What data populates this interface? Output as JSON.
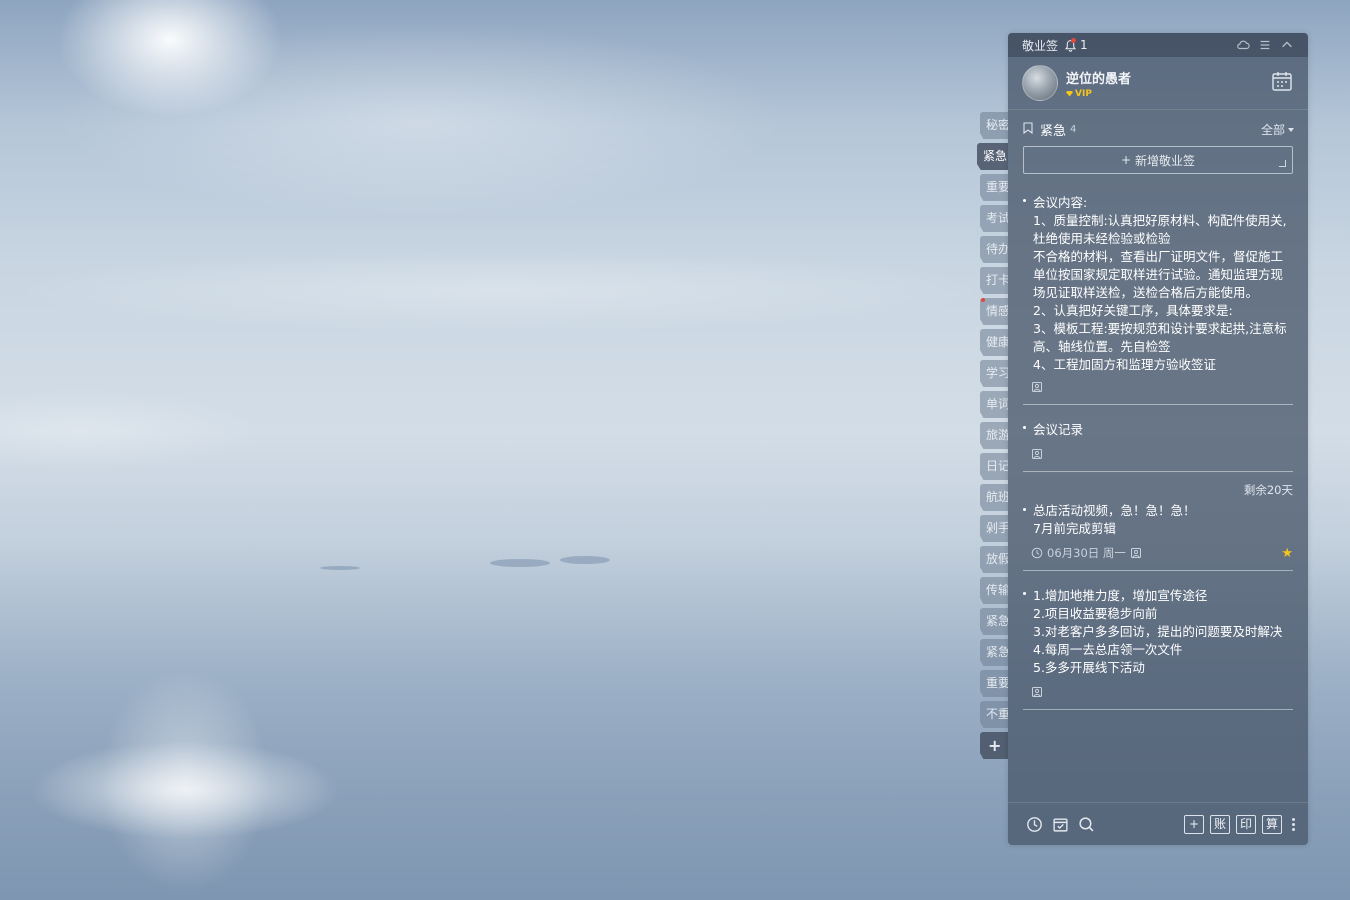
{
  "app": {
    "title": "敬业签",
    "notification_count": "1"
  },
  "user": {
    "name": "逆位的愚者",
    "badge": "VIP"
  },
  "tabs": [
    {
      "label": "秘密"
    },
    {
      "label": "紧急"
    },
    {
      "label": "重要"
    },
    {
      "label": "考试"
    },
    {
      "label": "待办"
    },
    {
      "label": "打卡"
    },
    {
      "label": "情感"
    },
    {
      "label": "健康"
    },
    {
      "label": "学习"
    },
    {
      "label": "单词"
    },
    {
      "label": "旅游"
    },
    {
      "label": "日记"
    },
    {
      "label": "航班"
    },
    {
      "label": "剁手"
    },
    {
      "label": "放假"
    },
    {
      "label": "传输"
    },
    {
      "label": "紧急"
    },
    {
      "label": "紧急"
    },
    {
      "label": "重要"
    },
    {
      "label": "不重"
    },
    {
      "label": "+"
    }
  ],
  "category": {
    "name": "紧急",
    "count": "4",
    "filter": "全部"
  },
  "new_note_label": "新增敬业签",
  "notes": [
    {
      "content": "会议内容:\n1、质量控制:认真把好原材料、构配件使用关,杜绝使用未经检验或检验\n不合格的材料，查看出厂证明文件，督促施工单位按国家规定取样进行试验。通知监理方现场见证取样送检，送检合格后方能使用。\n2、认真把好关键工序，具体要求是:\n3、模板工程:要按规范和设计要求起拱,注意标高、轴线位置。先自检签\n4、工程加固方和监理方验收签证"
    },
    {
      "content": "会议记录"
    },
    {
      "remaining": "剩余20天",
      "content": "总店活动视频，急！急！急！\n7月前完成剪辑",
      "date": "06月30日 周一"
    },
    {
      "content": "1.增加地推力度，增加宣传途径\n2.项目收益要稳步向前\n3.对老客户多多回访，提出的问题要及时解决\n4.每周一去总店领一次文件\n5.多多开展线下活动"
    }
  ],
  "bottom_buttons": {
    "add": "+",
    "account": "账",
    "print": "印",
    "calc": "算"
  }
}
